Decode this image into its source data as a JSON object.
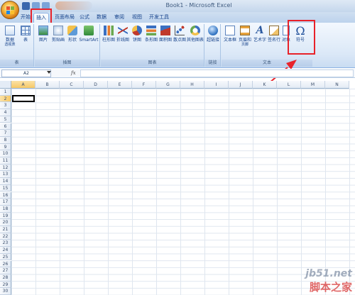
{
  "window": {
    "title": "Book1 - Microsoft Excel"
  },
  "tabs": [
    "开始",
    "插入",
    "页面布局",
    "公式",
    "数据",
    "审阅",
    "视图",
    "开发工具"
  ],
  "active_tab": "插入",
  "ribbon": {
    "groups": [
      {
        "label": "表",
        "buttons": [
          {
            "label": "数据",
            "sub": "透视表"
          },
          {
            "label": "表",
            "sub": ""
          }
        ]
      },
      {
        "label": "插图",
        "buttons": [
          {
            "label": "图片",
            "sub": ""
          },
          {
            "label": "剪贴画",
            "sub": ""
          },
          {
            "label": "形状",
            "sub": ""
          },
          {
            "label": "SmartArt",
            "sub": ""
          }
        ]
      },
      {
        "label": "图表",
        "buttons": [
          {
            "label": "柱形图",
            "sub": ""
          },
          {
            "label": "折线图",
            "sub": ""
          },
          {
            "label": "饼图",
            "sub": ""
          },
          {
            "label": "条形图",
            "sub": ""
          },
          {
            "label": "面积图",
            "sub": ""
          },
          {
            "label": "散点图",
            "sub": ""
          },
          {
            "label": "其他图表",
            "sub": ""
          }
        ]
      },
      {
        "label": "链接",
        "buttons": [
          {
            "label": "超链接",
            "sub": ""
          }
        ]
      },
      {
        "label": "文本",
        "buttons": [
          {
            "label": "文本框",
            "sub": ""
          },
          {
            "label": "页眉和",
            "sub": "页脚"
          },
          {
            "label": "艺术字",
            "sub": ""
          },
          {
            "label": "签名行",
            "sub": ""
          },
          {
            "label": "对象",
            "sub": ""
          },
          {
            "label": "符号",
            "sub": ""
          }
        ]
      }
    ]
  },
  "formula_bar": {
    "name_box": "A2",
    "fx": "fx",
    "value": ""
  },
  "grid": {
    "columns": [
      "A",
      "B",
      "C",
      "D",
      "E",
      "F",
      "G",
      "H",
      "I",
      "J",
      "K",
      "L",
      "M",
      "N"
    ],
    "rows": [
      "1",
      "2",
      "3",
      "4",
      "5",
      "6",
      "7",
      "8",
      "9",
      "10",
      "11",
      "12",
      "13",
      "14",
      "15",
      "16",
      "17",
      "18",
      "19",
      "20",
      "21",
      "22",
      "23",
      "24",
      "25",
      "26",
      "27",
      "28",
      "29",
      "30"
    ],
    "selected_cell": "A2"
  },
  "watermark": {
    "line1": "jb51.net",
    "line2": "脚本之家"
  },
  "colors": {
    "highlight": "#e8222a",
    "ribbon": "#dbe8f7",
    "accent": "#15428b"
  }
}
